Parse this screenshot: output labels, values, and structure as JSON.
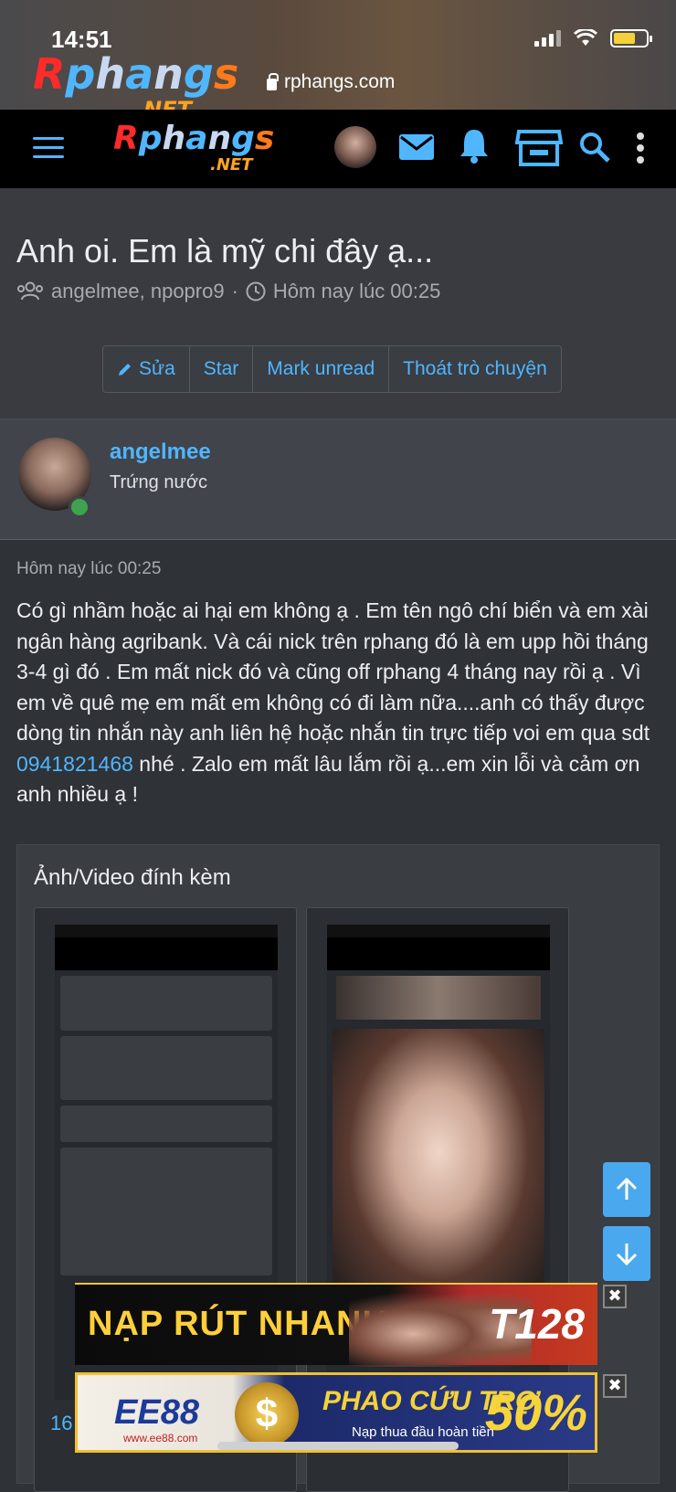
{
  "status_bar": {
    "time": "14:51"
  },
  "browser": {
    "url": "rphangs.com",
    "logo_text": "Rphangs",
    "logo_sub": ".NET"
  },
  "nav": {
    "logo_text": "Rphangs",
    "logo_sub": ".NET"
  },
  "thread": {
    "title": "Anh oi. Em là mỹ chi đây ạ...",
    "participants": "angelmee, npopro9",
    "separator": "·",
    "time": "Hôm nay lúc 00:25",
    "buttons": [
      "Sửa",
      "Star",
      "Mark unread",
      "Thoát trò chuyện"
    ]
  },
  "author": {
    "name": "angelmee",
    "role": "Trứng nước"
  },
  "post": {
    "time": "Hôm nay lúc 00:25",
    "body_before_phone": "Có gì nhầm hoặc ai hại em không ạ . Em tên ngô chí biển và em xài ngân hàng agribank. Và cái nick trên rphang đó là em upp hồi tháng 3-4 gì đó . Em mất nick đó và cũng off rphang 4 tháng nay rồi ạ . Vì em về quê mẹ em mất em không có đi làm nữa....anh có thấy được dòng tin nhắn này anh liên hệ hoặc nhắn tin trực tiếp voi em qua sdt ",
    "phone": "0941821468",
    "body_after_phone": " nhé . Zalo em mất lâu lắm rồi ạ...em xin lỗi và cảm ơn anh nhiều ạ !"
  },
  "attachments": {
    "title": "Ảnh/Video đính kèm",
    "count_partial": "16"
  },
  "ads": {
    "ad1_text": "NẠP RÚT NHANH",
    "ad1_brand": "T128",
    "ad2_brand": "EE88",
    "ad2_sub": "www.ee88.com",
    "ad2_text": "PHAO CỨU TRỢ",
    "ad2_small": "Nạp thua đầu hoàn tiền",
    "ad2_pct": "50%",
    "close": "✖"
  },
  "colors": {
    "accent": "#4fb6ff",
    "background": "#2f3237",
    "online": "#3fa24f"
  }
}
